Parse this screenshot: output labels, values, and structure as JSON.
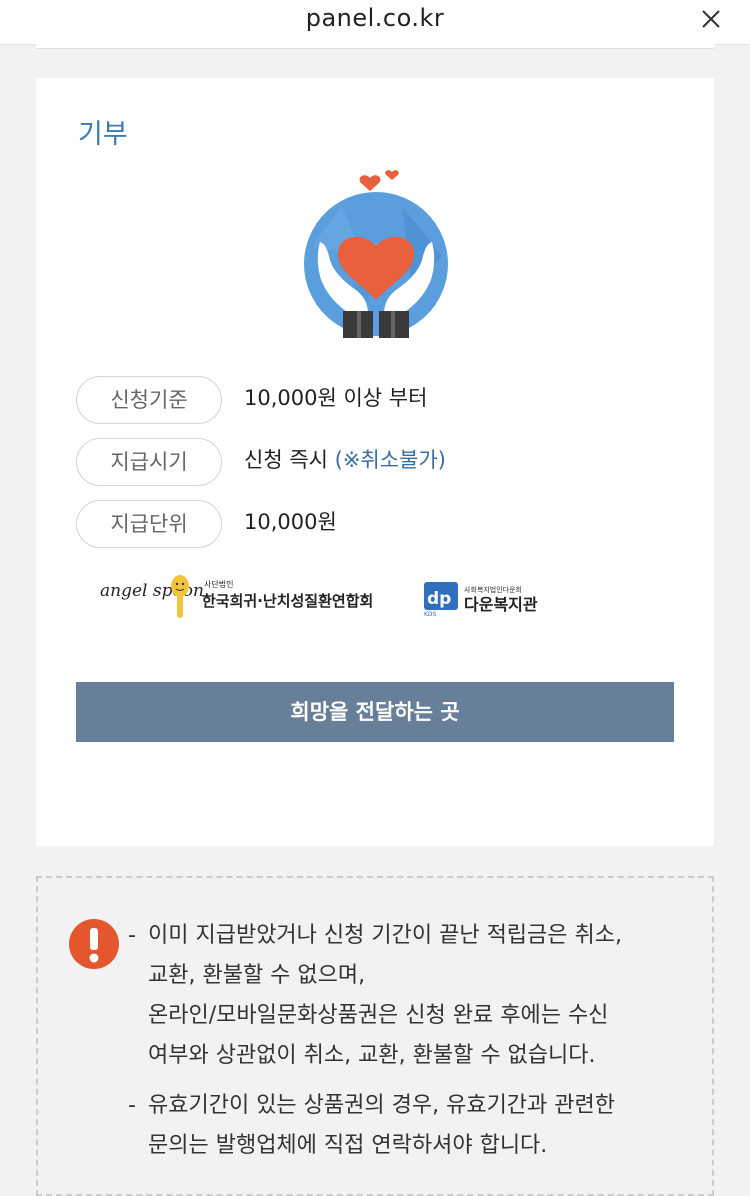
{
  "browser": {
    "url": "panel.co.kr"
  },
  "section": {
    "title": "기부"
  },
  "details": [
    {
      "label": "신청기준",
      "value": "10,000원 이상 부터",
      "note": ""
    },
    {
      "label": "지급시기",
      "value": "신청 즉시 ",
      "note": "(※취소불가)"
    },
    {
      "label": "지급단위",
      "value": "10,000원",
      "note": ""
    }
  ],
  "partners": {
    "angel_spoon_art": "angel spoon",
    "angel_spoon_tag": "사단법인",
    "angel_spoon_name": "한국희귀·난치성질환연합회",
    "dawoon_tag": "사회복지법인다운회",
    "dawoon_name": "다운복지관",
    "dawoon_mark": "dp",
    "dawoon_sub": "KDS"
  },
  "cta": {
    "label": "희망을 전달하는 곳"
  },
  "notice": {
    "icon": "exclamation-icon",
    "items": [
      {
        "lines": [
          "이미 지급받았거나 신청 기간이 끝난 적립금은 취소,",
          "교환, 환불할 수 없으며,",
          "온라인/모바일문화상품권은 신청 완료 후에는 수신",
          "여부와 상관없이 취소, 교환, 환불할 수 없습니다."
        ]
      },
      {
        "lines": [
          "유효기간이 있는 상품권의 경우, 유효기간과 관련한",
          "문의는 발행업체에 직접 연락하셔야 합니다."
        ]
      }
    ]
  },
  "colors": {
    "title_blue": "#3b7bb3",
    "cta_bg": "#677f98",
    "warning_red": "#e4572e",
    "heart": "#e8603c",
    "globe": "#5a9ede"
  }
}
